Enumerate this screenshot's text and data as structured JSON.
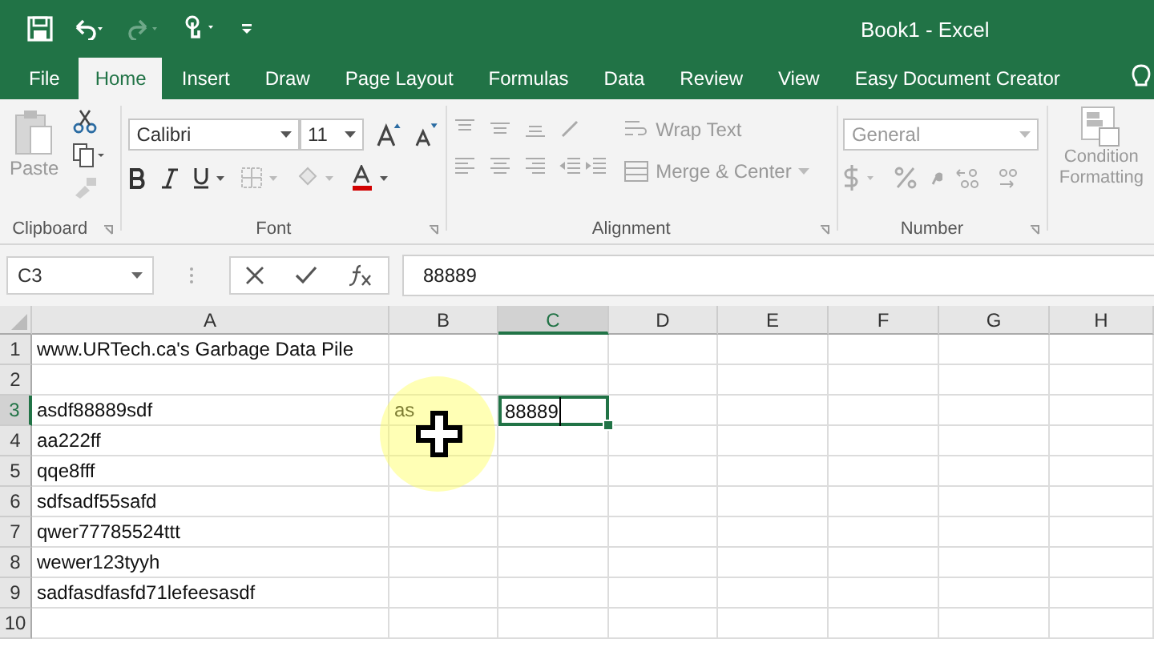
{
  "window": {
    "title": "Book1 - Excel"
  },
  "tabs": [
    {
      "label": "File",
      "selected": false
    },
    {
      "label": "Home",
      "selected": true
    },
    {
      "label": "Insert",
      "selected": false
    },
    {
      "label": "Draw",
      "selected": false
    },
    {
      "label": "Page Layout",
      "selected": false
    },
    {
      "label": "Formulas",
      "selected": false
    },
    {
      "label": "Data",
      "selected": false
    },
    {
      "label": "Review",
      "selected": false
    },
    {
      "label": "View",
      "selected": false
    },
    {
      "label": "Easy Document Creator",
      "selected": false
    }
  ],
  "ribbon": {
    "clipboard": {
      "label": "Clipboard",
      "paste": {
        "label": "Paste",
        "disabled": true
      }
    },
    "font": {
      "label": "Font",
      "font_name": "Calibri",
      "font_size": "11"
    },
    "alignment": {
      "label": "Alignment",
      "wrap_text": {
        "label": "Wrap Text",
        "disabled": true
      },
      "merge_center": {
        "label": "Merge & Center",
        "disabled": true
      }
    },
    "number": {
      "label": "Number",
      "format": {
        "value": "General",
        "disabled": true
      }
    },
    "styles": {
      "conditional_formatting": {
        "label_lines": [
          "Condition",
          "Formatting"
        ],
        "disabled": true
      }
    }
  },
  "formula_bar": {
    "name_box": "C3",
    "formula": "88889"
  },
  "sheet": {
    "edit_mode": true,
    "columns": [
      {
        "label": "A",
        "selected": false
      },
      {
        "label": "B",
        "selected": false
      },
      {
        "label": "C",
        "selected": true
      },
      {
        "label": "D",
        "selected": false
      },
      {
        "label": "E",
        "selected": false
      },
      {
        "label": "F",
        "selected": false
      },
      {
        "label": "G",
        "selected": false
      },
      {
        "label": "H",
        "selected": false
      }
    ],
    "rows": [
      {
        "header": "1",
        "selected": false,
        "cells": [
          "www.URTech.ca's Garbage Data Pile"
        ]
      },
      {
        "header": "2",
        "selected": false,
        "cells": []
      },
      {
        "header": "3",
        "selected": true,
        "cells": [
          "asdf88889sdf",
          "as",
          "88889"
        ]
      },
      {
        "header": "4",
        "selected": false,
        "cells": [
          "aa222ff"
        ]
      },
      {
        "header": "5",
        "selected": false,
        "cells": [
          "qqe8fff"
        ]
      },
      {
        "header": "6",
        "selected": false,
        "cells": [
          "sdfsadf55safd"
        ]
      },
      {
        "header": "7",
        "selected": false,
        "cells": [
          "qwer77785524ttt"
        ]
      },
      {
        "header": "8",
        "selected": false,
        "cells": [
          "wewer123tyyh"
        ]
      },
      {
        "header": "9",
        "selected": false,
        "cells": [
          "sadfasdfasfd71lefeesasdf"
        ]
      },
      {
        "header": "10",
        "selected": false,
        "cells": []
      }
    ]
  }
}
